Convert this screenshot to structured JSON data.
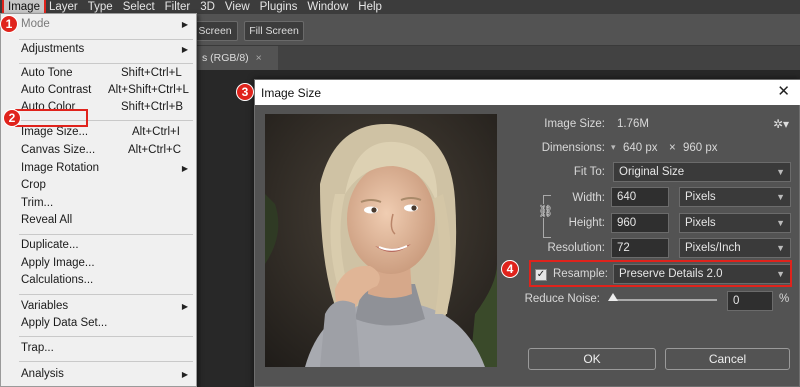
{
  "menubar": [
    "Image",
    "Layer",
    "Type",
    "Select",
    "Filter",
    "3D",
    "View",
    "Plugins",
    "Window",
    "Help"
  ],
  "optionsbar": {
    "screen_btn": "Screen",
    "fill_btn": "Fill Screen"
  },
  "tab": {
    "title": "s (RGB/8)",
    "close": "×"
  },
  "image_menu": {
    "mode": "Mode",
    "adjustments": "Adjustments",
    "auto_tone": "Auto Tone",
    "auto_tone_sc": "Shift+Ctrl+L",
    "auto_contrast": "Auto Contrast",
    "auto_contrast_sc": "Alt+Shift+Ctrl+L",
    "auto_color": "Auto Color",
    "auto_color_sc": "Shift+Ctrl+B",
    "image_size": "Image Size...",
    "image_size_sc": "Alt+Ctrl+I",
    "canvas_size": "Canvas Size...",
    "canvas_size_sc": "Alt+Ctrl+C",
    "image_rotation": "Image Rotation",
    "crop": "Crop",
    "trim": "Trim...",
    "reveal_all": "Reveal All",
    "duplicate": "Duplicate...",
    "apply_image": "Apply Image...",
    "calculations": "Calculations...",
    "variables": "Variables",
    "apply_data_set": "Apply Data Set...",
    "trap": "Trap...",
    "analysis": "Analysis"
  },
  "badges": [
    "1",
    "2",
    "3",
    "4"
  ],
  "dialog": {
    "title": "Image Size",
    "close": "✕",
    "image_size_label": "Image Size:",
    "image_size_value": "1.76M",
    "dimensions_label": "Dimensions:",
    "dim_w": "640 px",
    "dim_x": "×",
    "dim_h": "960 px",
    "fit_to_label": "Fit To:",
    "fit_to_value": "Original Size",
    "width_label": "Width:",
    "width_value": "640",
    "width_unit": "Pixels",
    "height_label": "Height:",
    "height_value": "960",
    "height_unit": "Pixels",
    "resolution_label": "Resolution:",
    "resolution_value": "72",
    "resolution_unit": "Pixels/Inch",
    "resample_label": "Resample:",
    "resample_value": "Preserve Details 2.0",
    "resample_checked": true,
    "reduce_noise_label": "Reduce Noise:",
    "reduce_noise_value": "0",
    "reduce_noise_unit": "%",
    "ok": "OK",
    "cancel": "Cancel"
  },
  "colors": {
    "highlight": "#e0231c",
    "menu_bg": "#f0f0f0",
    "dialog_bg": "#535353"
  }
}
